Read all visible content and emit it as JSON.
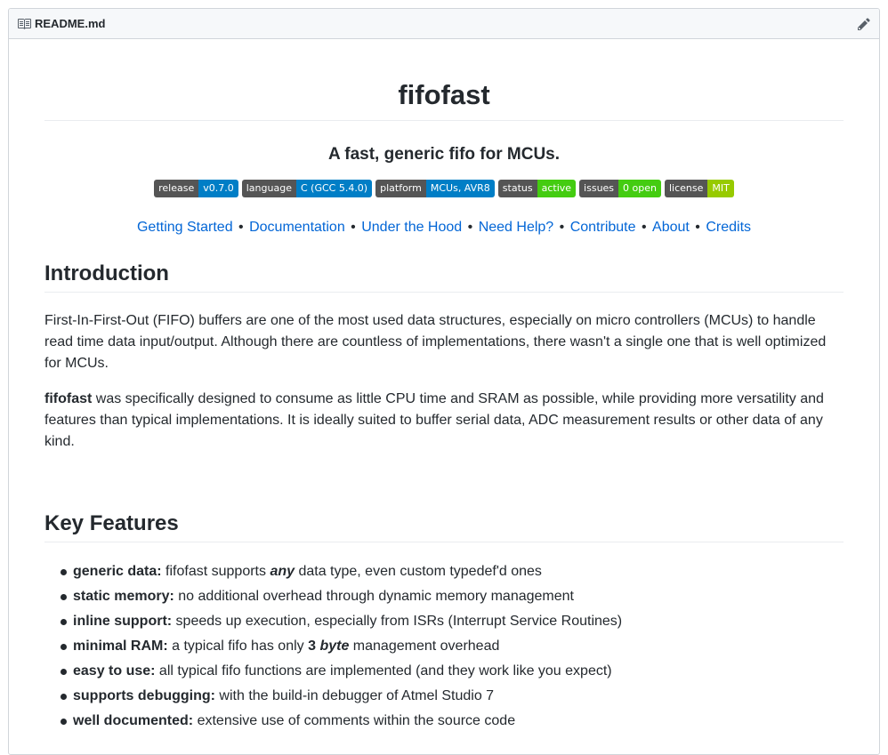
{
  "header": {
    "filename": "README.md",
    "book_icon": "book-icon",
    "edit_icon": "pencil-icon"
  },
  "title": "fifofast",
  "subtitle": "A fast, generic fifo for MCUs.",
  "badges": [
    {
      "label": "release",
      "value": "v0.7.0",
      "color": "#007ec6"
    },
    {
      "label": "language",
      "value": "C (GCC 5.4.0)",
      "color": "#007ec6"
    },
    {
      "label": "platform",
      "value": "MCUs, AVR8",
      "color": "#007ec6"
    },
    {
      "label": "status",
      "value": "active",
      "color": "#4c1"
    },
    {
      "label": "issues",
      "value": "0 open",
      "color": "#4c1"
    },
    {
      "label": "license",
      "value": "MIT",
      "color": "#97ca00"
    }
  ],
  "nav": {
    "links": [
      "Getting Started",
      "Documentation",
      "Under the Hood",
      "Need Help?",
      "Contribute",
      "About",
      "Credits"
    ],
    "separator": "•"
  },
  "intro": {
    "heading": "Introduction",
    "p1": "First-In-First-Out (FIFO) buffers are one of the most used data structures, especially on micro controllers (MCUs) to handle read time data input/output. Although there are countless of implementations, there wasn't a single one that is well optimized for MCUs.",
    "p2_bold": "fifofast",
    "p2_rest": " was specifically designed to consume as little CPU time and SRAM as possible, while providing more versatility and features than typical implementations. It is ideally suited to buffer serial data, ADC measurement results or other data of any kind."
  },
  "features": {
    "heading": "Key Features",
    "items": [
      {
        "bold": "generic data:",
        "text_before": " fifofast supports ",
        "emph": "any",
        "text_after": " data type, even custom typedef'd ones"
      },
      {
        "bold": "static memory:",
        "text": " no additional overhead through dynamic memory management"
      },
      {
        "bold": "inline support:",
        "text": " speeds up execution, especially from ISRs (Interrupt Service Routines)"
      },
      {
        "bold": "minimal RAM:",
        "text_before": " a typical fifo has only ",
        "strong": "3",
        "emph": "byte",
        "text_after": " management overhead"
      },
      {
        "bold": "easy to use:",
        "text": " all typical fifo functions are implemented (and they work like you expect)"
      },
      {
        "bold": "supports debugging:",
        "text": " with the build-in debugger of Atmel Studio 7"
      },
      {
        "bold": "well documented:",
        "text": " extensive use of comments within the source code"
      }
    ]
  }
}
